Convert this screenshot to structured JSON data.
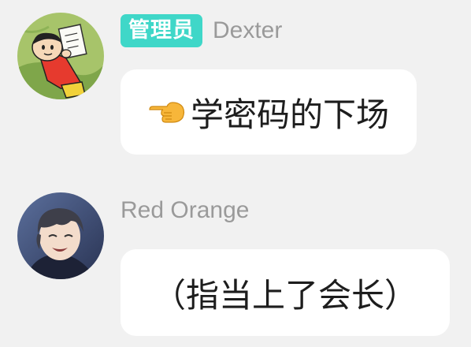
{
  "messages": [
    {
      "sender": "Dexter",
      "role_badge": "管理员",
      "avatar_icon": "cartoon-boy-avatar-icon",
      "emoji_icon": "backhand-pointing-left-icon",
      "text": "学密码的下场"
    },
    {
      "sender": "Red Orange",
      "avatar_icon": "anime-man-avatar-icon",
      "text": "（指当上了会长）"
    }
  ],
  "colors": {
    "background": "#f1f1f1",
    "bubble": "#ffffff",
    "role_badge": "#3fd7c8",
    "sender_name": "#9a9a9a",
    "message_text": "#1d1d1d"
  }
}
